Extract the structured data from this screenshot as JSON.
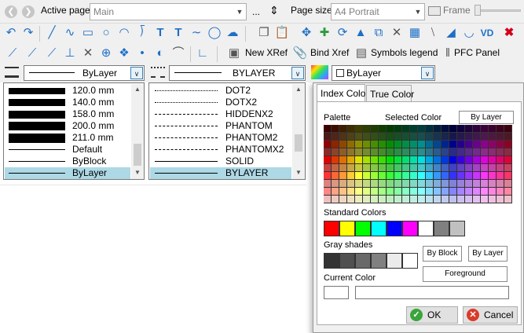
{
  "row1": {
    "active_page_label": "Active page",
    "active_page_value": "Main",
    "ellipsis": "...",
    "page_size_label": "Page size",
    "page_size_value": "A4 Portrait",
    "frame_label": "Frame"
  },
  "toolbar3": {
    "new_xref": "New XRef",
    "bind_xref": "Bind Xref",
    "symbols_legend": "Symbols legend",
    "pfc_panel": "PFC Panel"
  },
  "row4": {
    "lineweight_value": "ByLayer",
    "linetype_value": "BYLAYER",
    "color_value": "ByLayer"
  },
  "lineweight_list": [
    {
      "label": "120.0 mm"
    },
    {
      "label": "140.0 mm"
    },
    {
      "label": "158.0 mm"
    },
    {
      "label": "200.0 mm"
    },
    {
      "label": "211.0 mm"
    },
    {
      "label": "Default"
    },
    {
      "label": "ByBlock"
    },
    {
      "label": "ByLayer"
    }
  ],
  "linetype_list": [
    {
      "label": "DOT2"
    },
    {
      "label": "DOTX2"
    },
    {
      "label": "HIDDENX2"
    },
    {
      "label": "PHANTOM"
    },
    {
      "label": "PHANTOM2"
    },
    {
      "label": "PHANTOMX2"
    },
    {
      "label": "SOLID"
    },
    {
      "label": "BYLAYER"
    }
  ],
  "color_dialog": {
    "tab_index": "Index Color",
    "tab_true": "True Color",
    "palette_label": "Palette",
    "selected_color_label": "Selected Color",
    "by_layer_button": "By Layer",
    "standard_colors_label": "Standard Colors",
    "standard_colors": [
      "#ff0000",
      "#ffff00",
      "#00ff00",
      "#00ffff",
      "#0000ff",
      "#ff00ff",
      "#ffffff",
      "#808080",
      "#c0c0c0"
    ],
    "gray_shades_label": "Gray shades",
    "gray_shades": [
      "#333333",
      "#505050",
      "#696969",
      "#808080",
      "#ebebeb",
      "#ffffff"
    ],
    "by_block_button": "By Block",
    "by_layer_button2": "By Layer",
    "foreground_button": "Foreground",
    "current_color_label": "Current Color",
    "ok_button": "OK",
    "cancel_button": "Cancel"
  },
  "colors": {
    "selection": "#add8e6",
    "accent_blue": "#1e6fc7",
    "ok_green": "#3aa53a",
    "cancel_red": "#d83b2b"
  }
}
